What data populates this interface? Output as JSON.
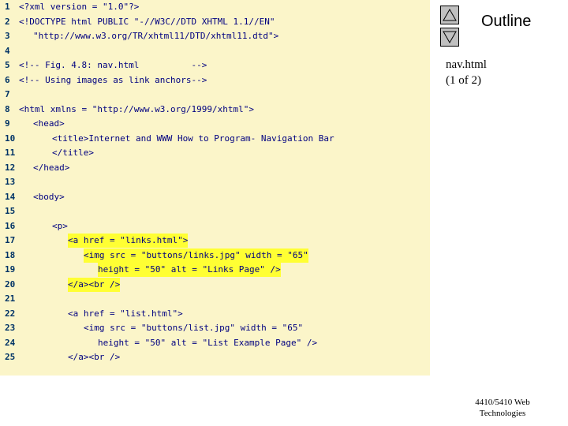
{
  "sidebar": {
    "outline_label": "Outline",
    "file_name": "nav.html",
    "page_info": "(1 of 2)",
    "footer_line1": "4410/5410 Web",
    "footer_line2": "Technologies"
  },
  "code_lines": [
    {
      "num": "1",
      "text": "<?xml version = \"1.0\"?>",
      "indent": 0,
      "highlight": false
    },
    {
      "num": "2",
      "text": "<!DOCTYPE html PUBLIC \"-//W3C//DTD XHTML 1.1//EN\"",
      "indent": 0,
      "highlight": false
    },
    {
      "num": "3",
      "text": "\"http://www.w3.org/TR/xhtml11/DTD/xhtml11.dtd\">",
      "indent": 1,
      "highlight": false
    },
    {
      "num": "4",
      "text": "",
      "indent": 0,
      "highlight": false
    },
    {
      "num": "5",
      "text": "<!-- Fig. 4.8: nav.html          -->",
      "indent": 0,
      "highlight": false
    },
    {
      "num": "6",
      "text": "<!-- Using images as link anchors-->",
      "indent": 0,
      "highlight": false
    },
    {
      "num": "7",
      "text": "",
      "indent": 0,
      "highlight": false
    },
    {
      "num": "8",
      "text": "<html xmlns = \"http://www.w3.org/1999/xhtml\">",
      "indent": 0,
      "highlight": false
    },
    {
      "num": "9",
      "text": "<head>",
      "indent": 1,
      "highlight": false
    },
    {
      "num": "10",
      "text": "<title>Internet and WWW How to Program- Navigation Bar",
      "indent": 2,
      "highlight": false
    },
    {
      "num": "11",
      "text": "</title>",
      "indent": 2,
      "highlight": false
    },
    {
      "num": "12",
      "text": "</head>",
      "indent": 1,
      "highlight": false
    },
    {
      "num": "13",
      "text": "",
      "indent": 0,
      "highlight": false
    },
    {
      "num": "14",
      "text": "<body>",
      "indent": 1,
      "highlight": false
    },
    {
      "num": "15",
      "text": "",
      "indent": 0,
      "highlight": false
    },
    {
      "num": "16",
      "text": "<p>",
      "indent": 2,
      "highlight": false
    },
    {
      "num": "17",
      "text": "<a href = \"links.html\">",
      "indent": 3,
      "highlight": true
    },
    {
      "num": "18",
      "text": "<img src = \"buttons/links.jpg\" width = \"65\"",
      "indent": 4,
      "highlight": true
    },
    {
      "num": "19",
      "text": "height = \"50\" alt = \"Links Page\" />",
      "indent": 5,
      "highlight": true
    },
    {
      "num": "20",
      "text": "</a><br />",
      "indent": 3,
      "highlight": true
    },
    {
      "num": "21",
      "text": "",
      "indent": 0,
      "highlight": false
    },
    {
      "num": "22",
      "text": "<a href = \"list.html\">",
      "indent": 3,
      "highlight": false
    },
    {
      "num": "23",
      "text": "<img src = \"buttons/list.jpg\" width = \"65\"",
      "indent": 4,
      "highlight": false
    },
    {
      "num": "24",
      "text": "height = \"50\" alt = \"List Example Page\" />",
      "indent": 5,
      "highlight": false
    },
    {
      "num": "25",
      "text": "</a><br />",
      "indent": 3,
      "highlight": false
    }
  ]
}
